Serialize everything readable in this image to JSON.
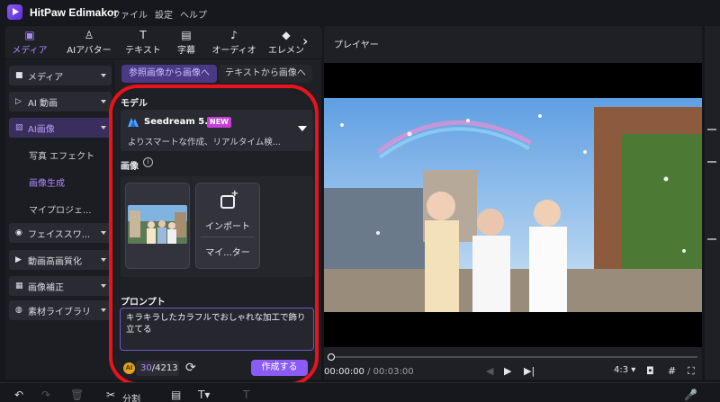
{
  "app": {
    "title": "HitPaw Edimakor",
    "menus": [
      "ファイル",
      "設定",
      "ヘルプ"
    ]
  },
  "toolbar": {
    "tabs": [
      {
        "label": "メディア",
        "icon": "media-icon",
        "active": true
      },
      {
        "label": "AIアバター",
        "icon": "ai-avatar-icon",
        "active": false
      },
      {
        "label": "テキスト",
        "icon": "text-icon",
        "active": false
      },
      {
        "label": "字幕",
        "icon": "subtitle-icon",
        "active": false
      },
      {
        "label": "オーディオ",
        "icon": "audio-icon",
        "active": false
      },
      {
        "label": "エレメン",
        "icon": "element-icon",
        "active": false
      }
    ]
  },
  "leftnav": {
    "items": [
      {
        "label": "メディア",
        "icon": "folder-icon"
      },
      {
        "label": "AI 動画",
        "icon": "ai-video-icon"
      },
      {
        "label": "AI画像",
        "icon": "ai-image-icon",
        "active": true
      },
      {
        "label": "フェイススワ...",
        "icon": "face-swap-icon"
      },
      {
        "label": "動画高画質化",
        "icon": "video-enhance-icon"
      },
      {
        "label": "画像補正",
        "icon": "image-fix-icon"
      },
      {
        "label": "素材ライブラリ",
        "icon": "library-icon"
      }
    ],
    "subitems": [
      {
        "label": "写真 エフェクト",
        "active": false
      },
      {
        "label": "画像生成",
        "active": true
      },
      {
        "label": "マイプロジェ...",
        "active": false
      }
    ]
  },
  "panel": {
    "seg_active": "参照画像から画像へ",
    "seg_inactive": "テキストから画像へ",
    "model_label": "モデル",
    "model_name": "Seedream 5.0",
    "model_badge": "NEW",
    "model_desc": "よりスマートな作成、リアルタイム検...",
    "image_label": "画像",
    "import_label": "インポート",
    "import_sub": "マイ...ター",
    "prompt_label": "プロンプト",
    "prompt_text": "キラキラしたカラフルでおしゃれな加工で飾り立てる",
    "credits_used": "30",
    "credits_total": "/4213",
    "create_button": "作成する"
  },
  "player": {
    "title": "プレイヤー",
    "current_time": "00:00:00",
    "total_time": " / 00:03:00",
    "aspect": "4:3"
  },
  "bottombar": {
    "split_label": "分割"
  },
  "colors": {
    "accent": "#8a5cf5",
    "highlight": "#e8131c",
    "background": "#16171c"
  }
}
